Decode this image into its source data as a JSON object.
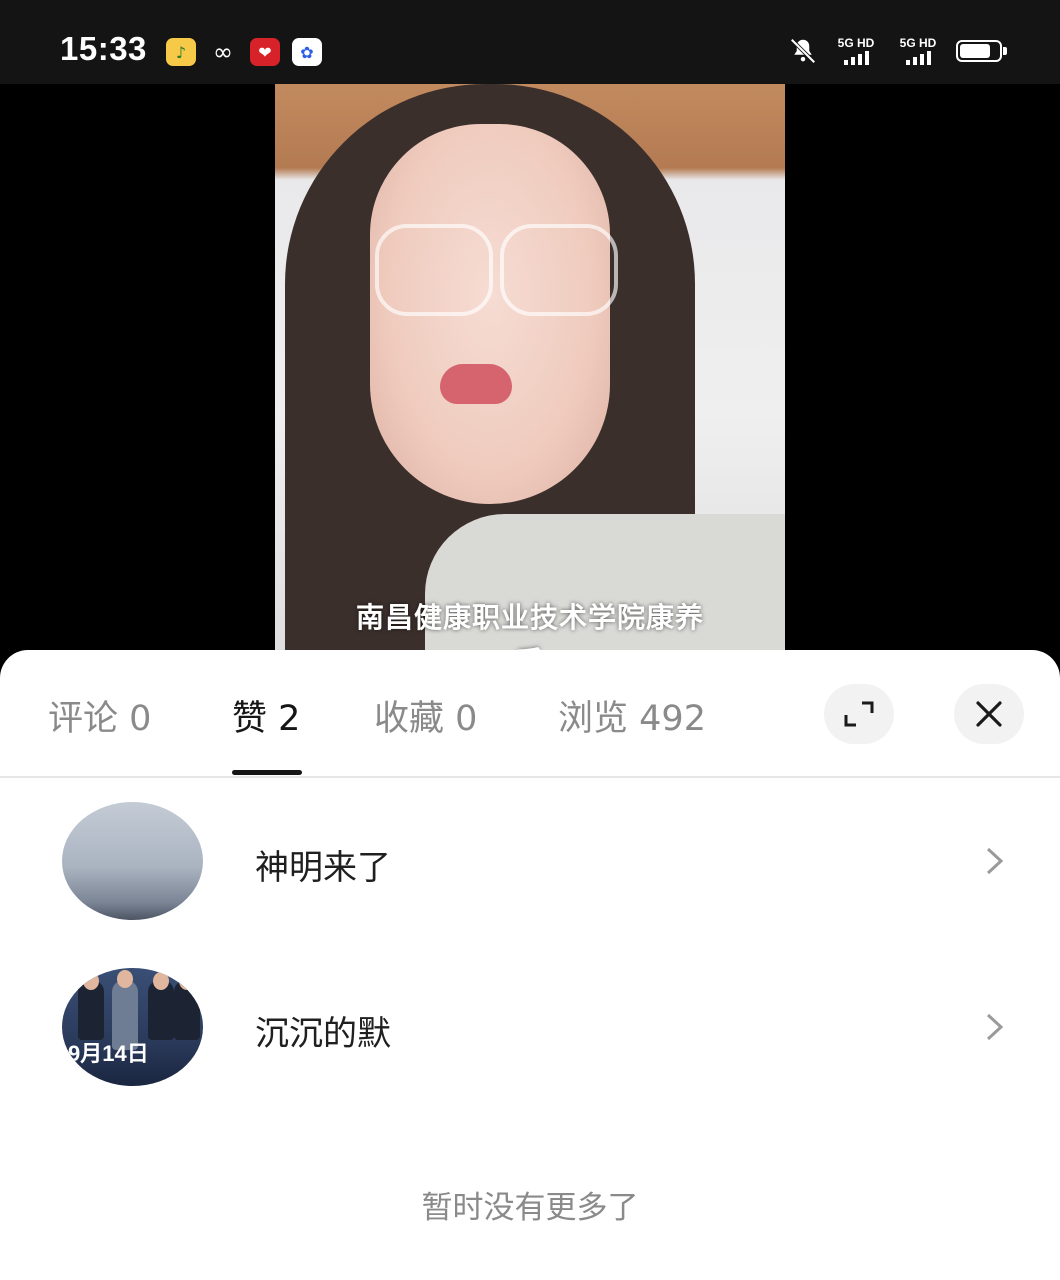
{
  "status_bar": {
    "time": "15:33",
    "signal1_label": "5G HD",
    "signal2_label": "5G HD",
    "battery_level": 0.8
  },
  "video": {
    "caption_line1": "南昌健康职业技术学院康养",
    "caption_line2": "系"
  },
  "tabs": [
    {
      "label": "评论",
      "count": "0"
    },
    {
      "label": "赞",
      "count": "2"
    },
    {
      "label": "收藏",
      "count": "0"
    },
    {
      "label": "浏览",
      "count": "492"
    }
  ],
  "active_tab": "赞",
  "users": [
    {
      "name": "神明来了"
    },
    {
      "name": "沉沉的默",
      "avatar_text": "9月14日"
    }
  ],
  "footer": {
    "no_more": "暂时没有更多了"
  },
  "colors": {
    "accent": "#161616",
    "muted": "#8a8a8a",
    "sheet_bg": "#ffffff"
  },
  "icons": [
    "qq-music-icon",
    "loop-icon",
    "heart-app-icon",
    "baidu-icon",
    "mute-icon",
    "battery-icon",
    "expand-icon",
    "close-icon",
    "chevron-right-icon"
  ]
}
